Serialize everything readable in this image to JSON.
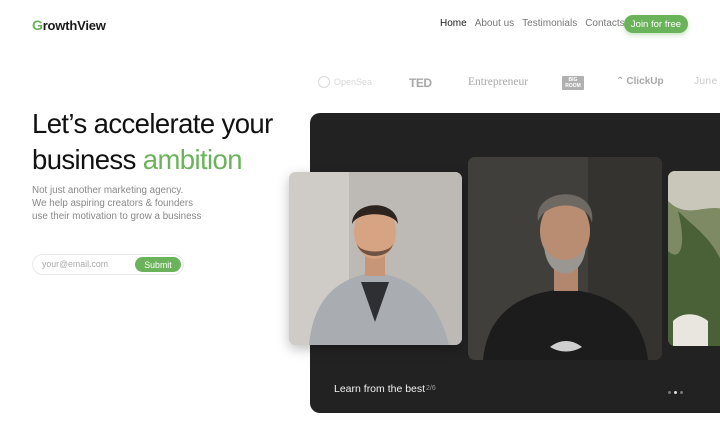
{
  "brand": {
    "logo_first": "G",
    "logo_rest": "rowthView"
  },
  "nav": {
    "items": [
      {
        "label": "Home",
        "active": true
      },
      {
        "label": "About us",
        "active": false
      },
      {
        "label": "Testimonials",
        "active": false
      },
      {
        "label": "Contacts",
        "active": false
      }
    ],
    "cta_label": "Join for free"
  },
  "partners": {
    "opensea": "OpenSea",
    "ted": "TED",
    "entrepreneur": "Entrepreneur",
    "bigroom_top": "BIG",
    "bigroom_bottom": "ROOM",
    "clickup": "ClickUp",
    "june": "June"
  },
  "hero": {
    "line1": "Let’s accelerate your",
    "line2_plain": "business ",
    "line2_accent": "ambition",
    "sub_line1": "Not just another marketing agency.",
    "sub_line2": "We help aspiring creators & founders",
    "sub_line3": "use their motivation to grow a business"
  },
  "signup": {
    "placeholder": "your@email.com",
    "submit_label": "Submit"
  },
  "carousel": {
    "caption": "Learn from the best",
    "counter": "2/6",
    "dot_count": 3,
    "active_dot": 1
  },
  "colors": {
    "accent": "#6bb35a",
    "panel": "#222222",
    "text": "#111111",
    "muted": "#888888"
  }
}
